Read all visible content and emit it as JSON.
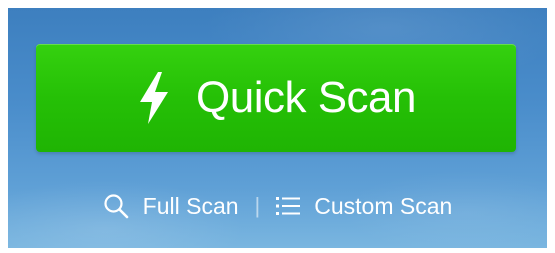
{
  "quick_scan": {
    "label": "Quick Scan",
    "icon": "lightning-bolt-icon",
    "color": "#25c006"
  },
  "full_scan": {
    "label": "Full Scan",
    "icon": "search-icon"
  },
  "separator": "|",
  "custom_scan": {
    "label": "Custom Scan",
    "icon": "list-icon"
  },
  "background_color": "#4a8dcb"
}
